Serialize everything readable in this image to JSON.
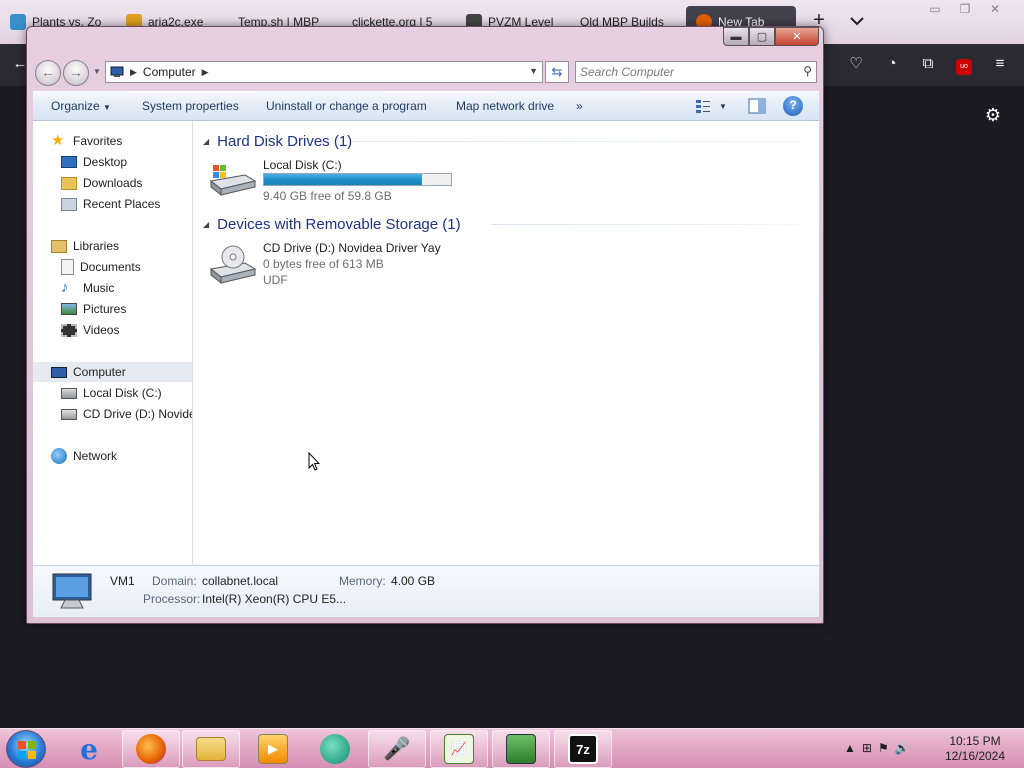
{
  "browser": {
    "tabs": [
      {
        "label": "Plants vs. Zo",
        "color": "#3a8fc9"
      },
      {
        "label": "aria2c.exe",
        "color": "#e0a21f"
      },
      {
        "label": "Temp.sh | MBP",
        "color": "#7a7a7a"
      },
      {
        "label": "clickette.org | 5",
        "color": "#7a7a7a"
      },
      {
        "label": "PVZM Level",
        "color": "#444444"
      },
      {
        "label": "Old MBP Builds",
        "color": "#7a7a7a"
      },
      {
        "label": "New Tab",
        "color": "#e66000"
      }
    ],
    "new_tab_symbol": "+"
  },
  "explorer": {
    "address": {
      "crumb": "Computer",
      "search_placeholder": "Search Computer"
    },
    "toolbar": {
      "organize": "Organize",
      "system_properties": "System properties",
      "uninstall": "Uninstall or change a program",
      "map_drive": "Map network drive",
      "more": "»",
      "help": "?"
    },
    "nav": {
      "favorites": "Favorites",
      "desktop": "Desktop",
      "downloads": "Downloads",
      "recent_places": "Recent Places",
      "libraries": "Libraries",
      "documents": "Documents",
      "music": "Music",
      "pictures": "Pictures",
      "videos": "Videos",
      "computer": "Computer",
      "local_disk": "Local Disk (C:)",
      "cd_drive": "CD Drive (D:) Novidea Driver Yay",
      "network": "Network"
    },
    "groups": {
      "hard_disks": "Hard Disk Drives (1)",
      "removable": "Devices with Removable Storage (1)"
    },
    "drives": {
      "c_name": "Local Disk (C:)",
      "c_free": "9.40 GB free of 59.8 GB",
      "c_used_fraction": 0.843,
      "d_name": "CD Drive (D:) Novidea Driver Yay",
      "d_free": "0 bytes free of 613 MB",
      "d_fs": "UDF"
    },
    "details": {
      "name": "VM1",
      "domain_label": "Domain:",
      "domain_value": "collabnet.local",
      "memory_label": "Memory:",
      "memory_value": "4.00 GB",
      "processor_label": "Processor:",
      "processor_value": "Intel(R) Xeon(R) CPU E5..."
    }
  },
  "taskbar": {
    "time": "10:15 PM",
    "date": "12/16/2024",
    "apps": [
      "internet-explorer",
      "firefox",
      "windows-explorer",
      "media-player",
      "browser-globe",
      "microphone-app",
      "notepad-chart-app",
      "network-card-app",
      "7-zip"
    ],
    "seven_zip_label": "7z"
  }
}
